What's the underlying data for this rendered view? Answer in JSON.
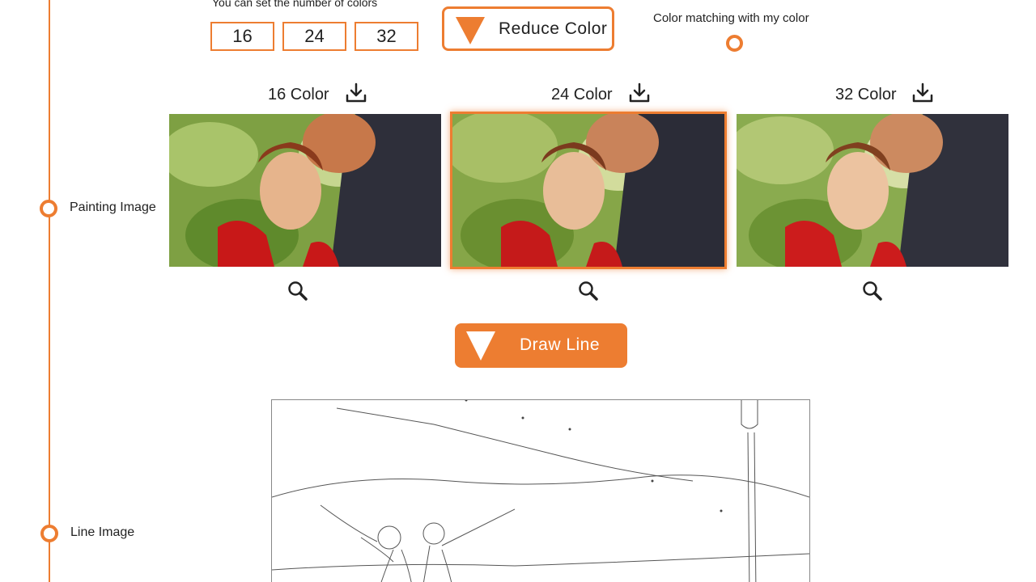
{
  "controls": {
    "hint": "You can set the number of colors",
    "counts": [
      "16",
      "24",
      "32"
    ],
    "reduce_label": "Reduce Color",
    "match_label": "Color matching with my color"
  },
  "timeline": {
    "painting_label": "Painting Image",
    "line_label": "Line Image"
  },
  "columns": [
    {
      "title": "16 Color",
      "selected": false
    },
    {
      "title": "24 Color",
      "selected": true
    },
    {
      "title": "32 Color",
      "selected": false
    }
  ],
  "draw_label": "Draw Line",
  "colors": {
    "accent": "#ED7D31"
  },
  "icons": [
    "download-icon",
    "zoom-icon",
    "triangle-down-icon"
  ]
}
